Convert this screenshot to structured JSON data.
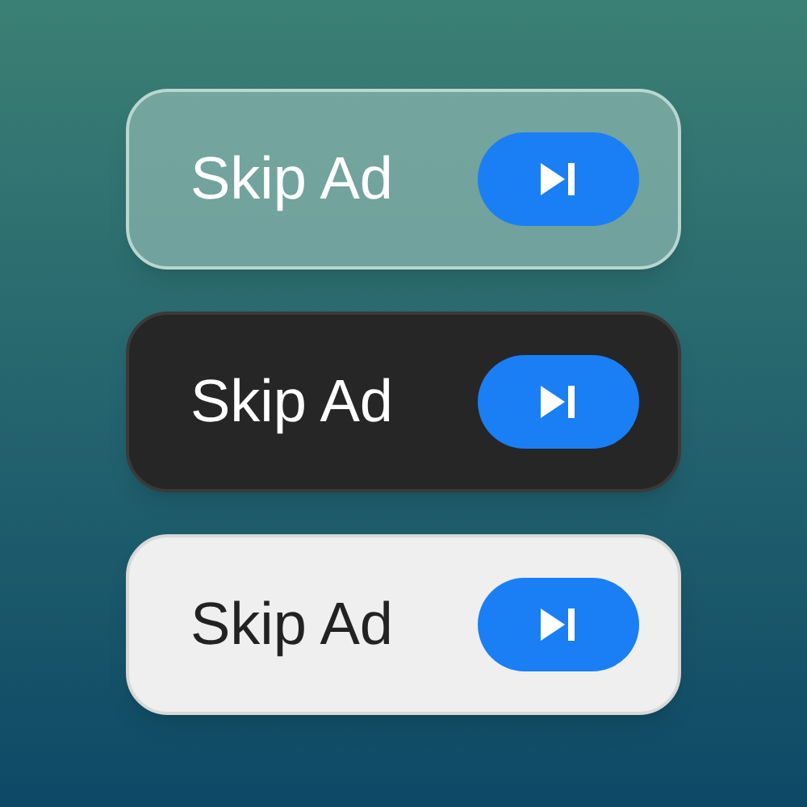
{
  "skip_buttons": [
    {
      "kind": "glass",
      "label": "Skip Ad"
    },
    {
      "kind": "dark",
      "label": "Skip Ad"
    },
    {
      "kind": "light",
      "label": "Skip Ad"
    }
  ]
}
